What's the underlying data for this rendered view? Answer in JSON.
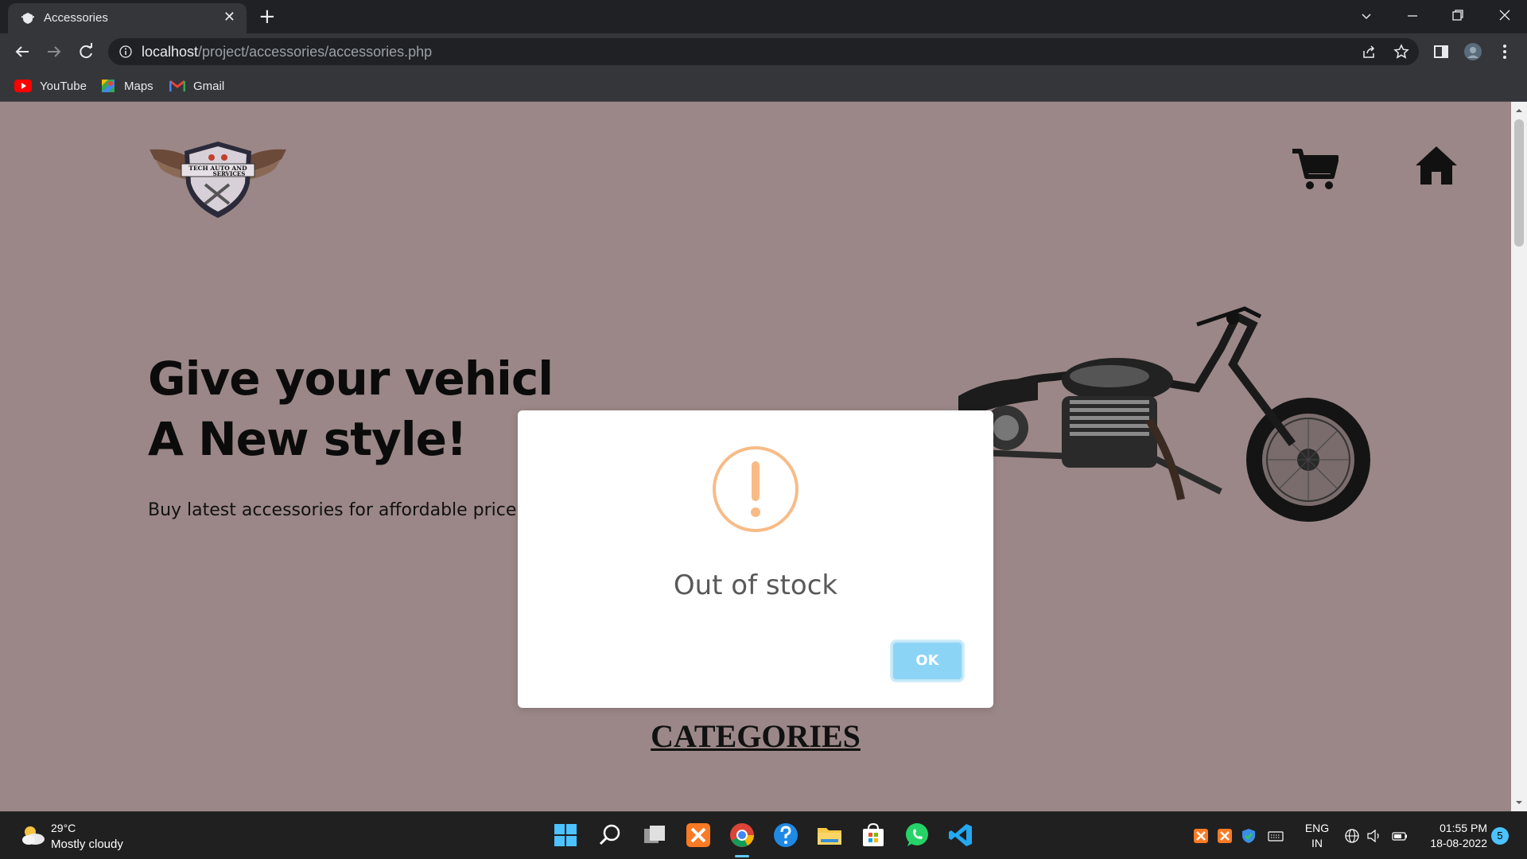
{
  "browser": {
    "tab_title": "Accessories",
    "tab_close": "✕",
    "new_tab": "+",
    "url_host": "localhost",
    "url_path": "/project/accessories/accessories.php",
    "bookmarks": [
      {
        "label": "YouTube",
        "icon": "youtube-icon"
      },
      {
        "label": "Maps",
        "icon": "maps-icon"
      },
      {
        "label": "Gmail",
        "icon": "gmail-icon"
      }
    ]
  },
  "page": {
    "background_color": "#9b8787",
    "logo_text_line1": "TECH AUTO AND",
    "logo_text_line2": "SERVICES",
    "hero_line1": "Give your vehicl",
    "hero_line2": "A New style!",
    "tagline": "Buy latest accessories for affordable price!",
    "categories_heading": "CATEGORIES"
  },
  "modal": {
    "icon": "warning-icon",
    "title": "Out of stock",
    "ok_label": "OK",
    "warning_color": "#f8bb86",
    "button_color": "#8cd4f5"
  },
  "taskbar": {
    "weather_temp": "29°C",
    "weather_desc": "Mostly cloudy",
    "lang_line1": "ENG",
    "lang_line2": "IN",
    "time": "01:55 PM",
    "date": "18-08-2022",
    "notification_count": "5"
  }
}
